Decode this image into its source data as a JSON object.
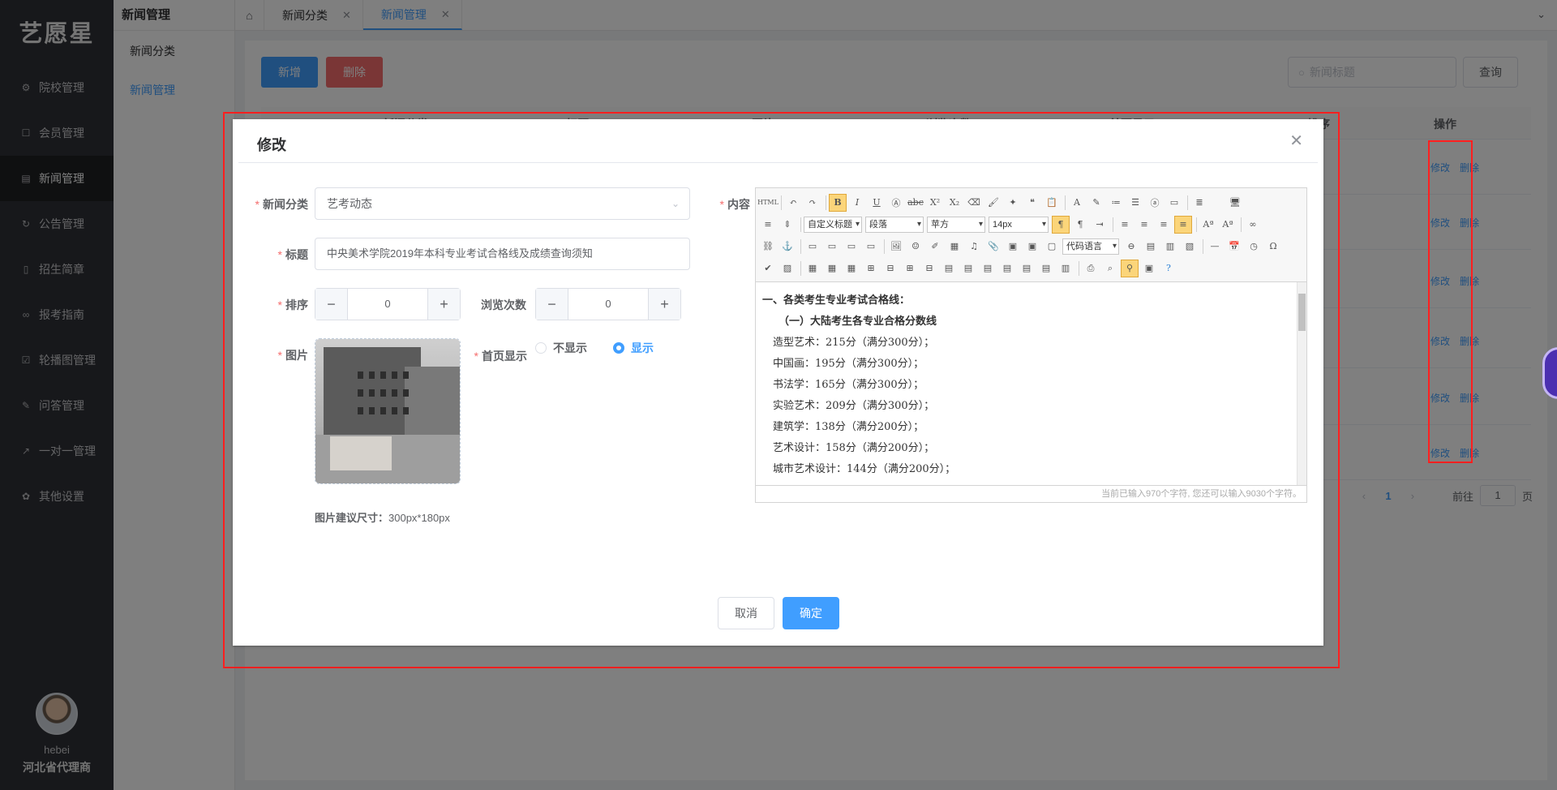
{
  "app": {
    "logo": "艺愿星"
  },
  "sidebar": {
    "items": [
      {
        "label": "院校管理",
        "icon": "gear-icon"
      },
      {
        "label": "会员管理",
        "icon": "cup-icon"
      },
      {
        "label": "新闻管理",
        "icon": "news-icon"
      },
      {
        "label": "公告管理",
        "icon": "refresh-icon"
      },
      {
        "label": "招生简章",
        "icon": "document-icon"
      },
      {
        "label": "报考指南",
        "icon": "link-icon"
      },
      {
        "label": "轮播图管理",
        "icon": "checkbox-icon"
      },
      {
        "label": "问答管理",
        "icon": "edit-icon"
      },
      {
        "label": "一对一管理",
        "icon": "arrow-icon"
      },
      {
        "label": "其他设置",
        "icon": "settings-icon"
      }
    ],
    "active": "新闻管理",
    "user": {
      "name": "hebei",
      "role": "河北省代理商"
    }
  },
  "submenu": {
    "title": "新闻管理",
    "items": [
      {
        "label": "新闻分类"
      },
      {
        "label": "新闻管理"
      }
    ]
  },
  "tabs": [
    {
      "label": "新闻分类"
    },
    {
      "label": "新闻管理"
    }
  ],
  "page": {
    "add_label": "新增",
    "delete_label": "删除",
    "search_placeholder": "新闻标题",
    "query_label": "查询",
    "columns": [
      "新闻分类",
      "标题",
      "图片",
      "浏览次数",
      "首页显示",
      "排序",
      "操作"
    ],
    "row_actions": {
      "edit": "修改",
      "delete": "删除"
    },
    "pagination": {
      "current": "1",
      "goto_label": "前往",
      "goto_value": "1",
      "page_unit": "页"
    }
  },
  "dialog": {
    "title": "修改",
    "fields": {
      "category_label": "新闻分类",
      "category_value": "艺考动态",
      "title_label": "标题",
      "title_value": "中央美术学院2019年本科专业考试合格线及成绩查询须知",
      "sort_label": "排序",
      "sort_value": "0",
      "views_label": "浏览次数",
      "views_value": "0",
      "image_label": "图片",
      "image_hint_label": "图片建议尺寸：",
      "image_hint_value": "300px*180px",
      "homepage_label": "首页显示",
      "homepage_options": [
        "不显示",
        "显示"
      ],
      "homepage_selected": "显示",
      "content_label": "内容"
    },
    "editor": {
      "combo_custom_title": "自定义标题",
      "combo_paragraph": "段落",
      "combo_font": "苹方",
      "combo_size": "14px",
      "combo_code": "代码语言",
      "lines": [
        "一、各类考生专业考试合格线：",
        "（一）大陆考生各专业合格分数线",
        "造型艺术：215分（满分300分）；",
        "中国画：195分（满分300分）；",
        "书法学：165分（满分300分）；",
        "实验艺术：209分（满分300分）；",
        "建筑学：138分（满分200分）；",
        "艺术设计：158分（满分200分）；",
        "城市艺术设计：144分（满分200分）；"
      ],
      "counter": "当前已输入970个字符, 您还可以输入9030个字符。"
    },
    "cancel_label": "取消",
    "confirm_label": "确定"
  }
}
